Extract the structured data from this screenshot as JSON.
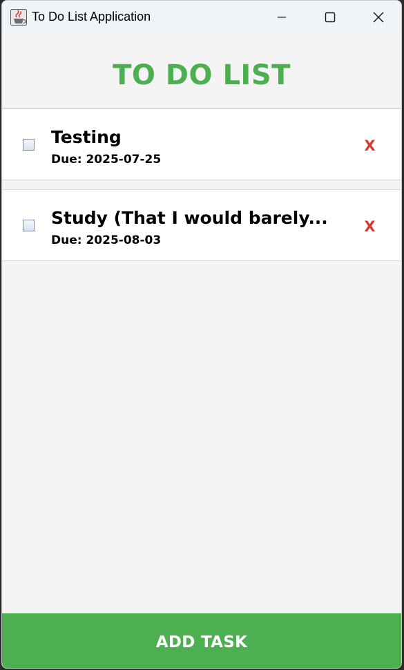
{
  "window": {
    "title": "To Do List Application",
    "icon": "java-cup-icon"
  },
  "header": {
    "title": "TO DO LIST"
  },
  "tasks": [
    {
      "title": "Testing",
      "due": "Due: 2025-07-25",
      "checked": false,
      "delete_label": "X"
    },
    {
      "title": "Study (That I would barely...",
      "due": "Due: 2025-08-03",
      "checked": false,
      "delete_label": "X"
    }
  ],
  "actions": {
    "add_task_label": "ADD TASK"
  },
  "colors": {
    "accent": "#4caf50",
    "delete": "#d63a35",
    "background": "#f4f4f4"
  }
}
